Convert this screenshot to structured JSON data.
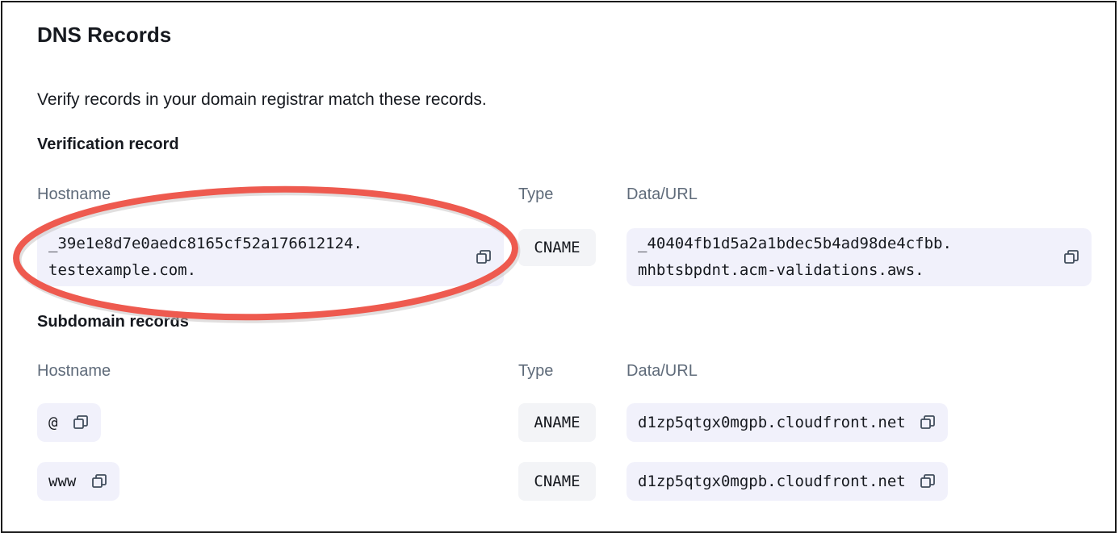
{
  "title": "DNS Records",
  "description": "Verify records in your domain registrar match these records.",
  "verification": {
    "heading": "Verification record",
    "columns": {
      "hostname": "Hostname",
      "type": "Type",
      "data": "Data/URL"
    },
    "record": {
      "hostname_line1": "_39e1e8d7e0aedc8165cf52a176612124.",
      "hostname_line2": "testexample.com.",
      "type": "CNAME",
      "data_line1": "_40404fb1d5a2a1bdec5b4ad98de4cfbb.",
      "data_line2": "mhbtsbpdnt.acm-validations.aws."
    }
  },
  "subdomain": {
    "heading": "Subdomain records",
    "columns": {
      "hostname": "Hostname",
      "type": "Type",
      "data": "Data/URL"
    },
    "records": [
      {
        "hostname": "@",
        "type": "ANAME",
        "data": "d1zp5qtgx0mgpb.cloudfront.net"
      },
      {
        "hostname": "www",
        "type": "CNAME",
        "data": "d1zp5qtgx0mgpb.cloudfront.net"
      }
    ]
  },
  "colors": {
    "chip_bg": "#f1f1fb",
    "annotation": "#ee5a4f",
    "icon": "#414d5c"
  },
  "icons": {
    "copy": "copy-icon"
  }
}
